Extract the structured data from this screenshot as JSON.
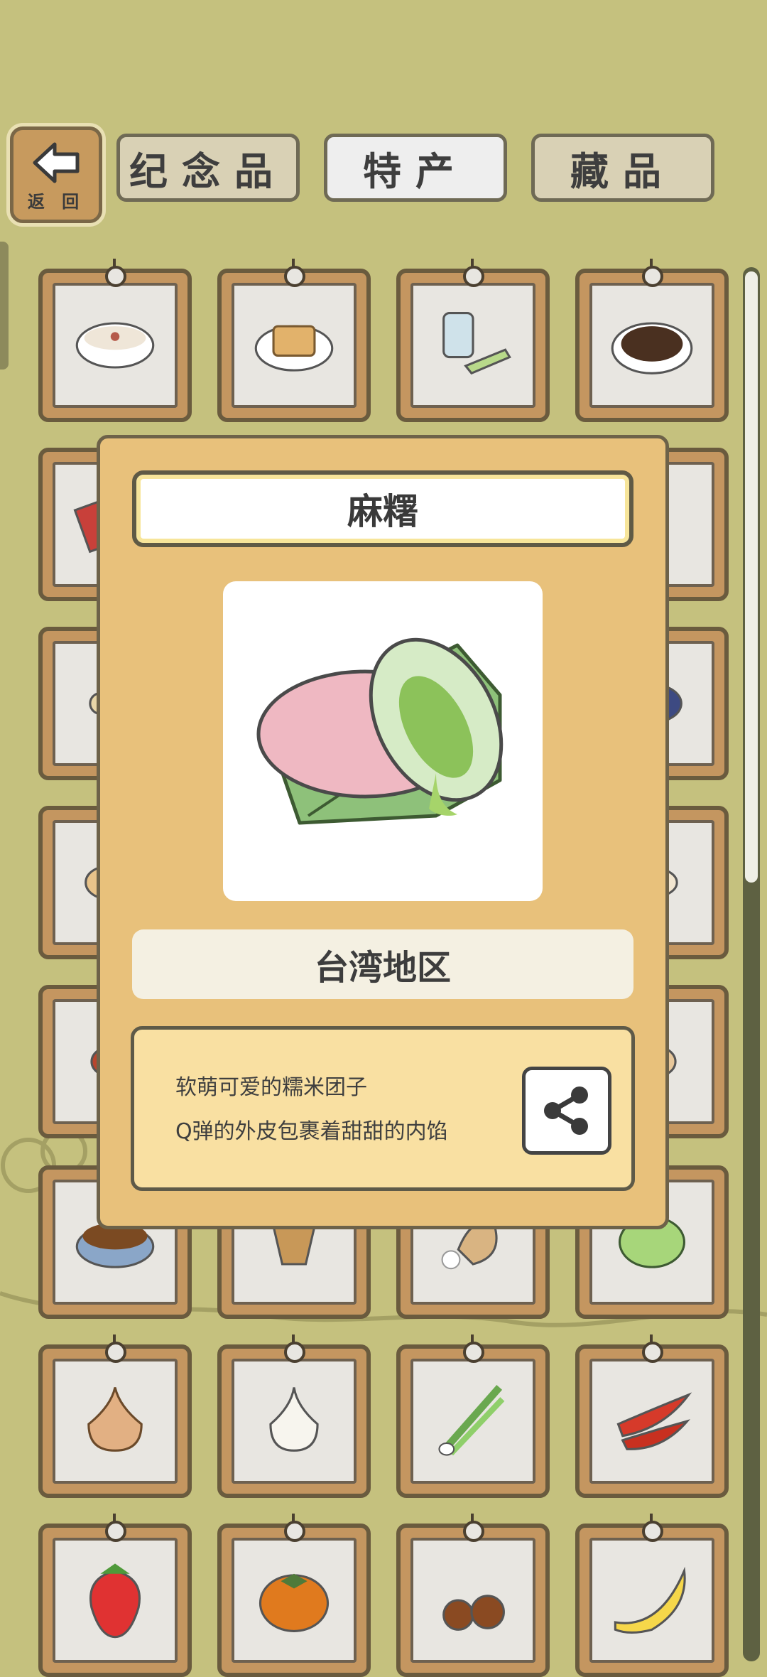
{
  "back_button": {
    "label": "返 回"
  },
  "tabs": [
    {
      "label": "纪念品",
      "active": false
    },
    {
      "label": "特产",
      "active": true
    },
    {
      "label": "藏品",
      "active": false
    }
  ],
  "grid_items": [
    "rice-porridge",
    "stinky-tofu",
    "tea-jar",
    "coffee-beans",
    "box",
    "unknown",
    "unknown",
    "cake",
    "ginger",
    "unknown",
    "unknown",
    "bowl",
    "buns",
    "unknown",
    "unknown",
    "dumplings",
    "sauce",
    "unknown",
    "unknown",
    "milk-tea",
    "nut-bowl",
    "peanuts",
    "rice-sack",
    "cabbage",
    "onion",
    "garlic",
    "scallion",
    "chili-pepper",
    "strawberry",
    "persimmon",
    "chestnuts",
    "banana"
  ],
  "modal": {
    "title": "麻糬",
    "image_icon": "mochi",
    "region": "台湾地区",
    "description": [
      "软萌可爱的糯米团子",
      "Q弹的外皮包裹着甜甜的内馅"
    ],
    "share_icon": "share-icon"
  },
  "colors": {
    "background": "#c5c17e",
    "modal": "#e8c17b",
    "card_frame": "#c49660"
  }
}
